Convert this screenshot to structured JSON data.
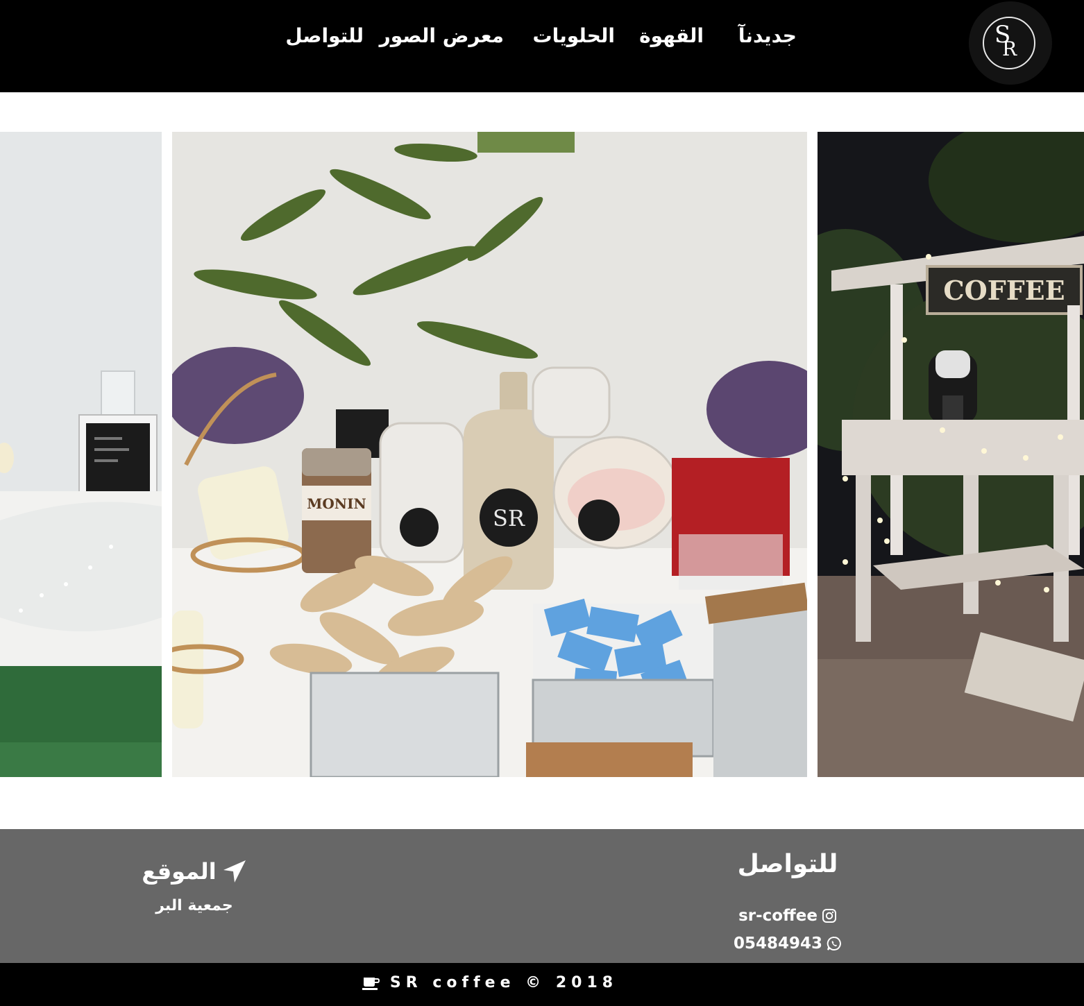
{
  "nav": {
    "links": [
      "جديدنآ",
      "القهوة",
      "الحلويات",
      "معرض الصور",
      "للتواصل"
    ],
    "logo_letters": [
      "S",
      "R"
    ]
  },
  "gallery": {
    "slide_right_sign": "COFFEE",
    "slide_center_labels": [
      "MONIN",
      "SR"
    ]
  },
  "footer": {
    "contact_title": "للتواصل",
    "instagram": "sr-coffee",
    "whatsapp": "05484943",
    "location_title": "الموقع",
    "location_text": "جمعية البر"
  },
  "bottom": {
    "copyright": "SR coffee © 2018"
  },
  "colors": {
    "nav_bg": "#000000",
    "footer_bg": "#676767",
    "text": "#ffffff"
  },
  "icons": [
    "instagram-icon",
    "whatsapp-icon",
    "location-arrow-icon",
    "coffee-cup-icon"
  ]
}
